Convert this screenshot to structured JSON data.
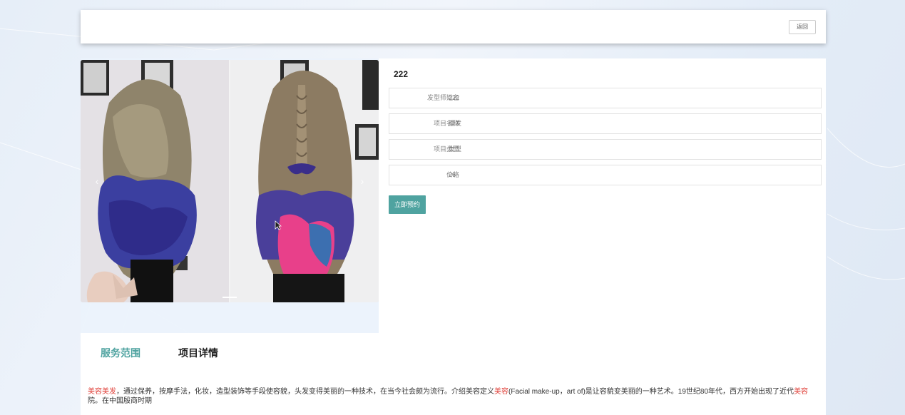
{
  "topbar": {
    "back_label": "返回"
  },
  "gallery": {
    "prev_glyph": "‹",
    "next_glyph": "›"
  },
  "detail": {
    "title": "222",
    "fields": [
      {
        "label": "发型师姓名",
        "value": "222"
      },
      {
        "label": "项目名称",
        "value": "理发"
      },
      {
        "label": "项目类型",
        "value": "类型"
      },
      {
        "label": "价格",
        "value": "26"
      }
    ],
    "book_label": "立即预约"
  },
  "tabs": [
    {
      "label": "服务范围",
      "active": true
    },
    {
      "label": "项目详情",
      "active": false
    }
  ],
  "description": {
    "parts": [
      "美容美发",
      "，通过保养，按摩手法，化妆，造型装饰等手段使容貌，头发变得美丽的一种技术，在当今社会颇为流行。介绍美容定义",
      "美容",
      "(Facial make-up，art of)是让容貌变美丽的一种艺术。19世纪80年代，西方开始出现了近代",
      "美容",
      "院。在中国殷商时期"
    ]
  },
  "colors": {
    "accent": "#4fa3a0",
    "highlight": "#e0413a"
  }
}
